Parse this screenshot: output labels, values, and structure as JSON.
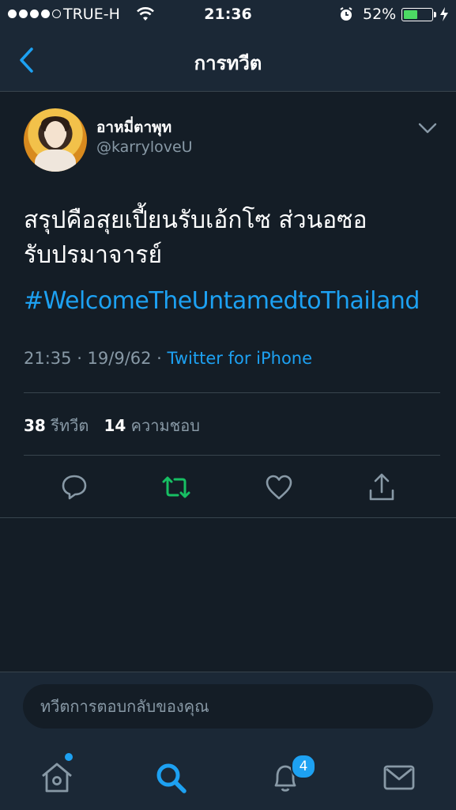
{
  "status_bar": {
    "carrier": "TRUE-H",
    "time": "21:36",
    "battery_percent": "52%",
    "battery_level": 0.52,
    "signal_bars_filled": 4,
    "signal_bars_total": 5
  },
  "nav": {
    "title": "การทวีต"
  },
  "tweet": {
    "author_name": "อาหมี่ตาพุท",
    "author_handle": "@karryloveU",
    "text_lines": [
      "สรุปคือสุยเปี้ยนรับเอ้กโซ ส่วนอซอ",
      "รับปรมาจารย์"
    ],
    "hashtag": "#WelcomeTheUntamedtoThailand",
    "timestamp": "21:35 · 19/9/62 · ",
    "source": "Twitter for iPhone",
    "retweet_count": "38",
    "retweet_label": "รีทวีต",
    "like_count": "14",
    "like_label": "ความชอบ"
  },
  "reply": {
    "placeholder": "ทวีตการตอบกลับของคุณ"
  },
  "tab_bar": {
    "notifications_badge": "4",
    "active_tab": "search"
  },
  "colors": {
    "background": "#141d26",
    "bar": "#1b2836",
    "accent": "#1da1f2",
    "retweet_active": "#17bf63",
    "secondary_text": "#8899a6",
    "divider": "#38444d"
  }
}
